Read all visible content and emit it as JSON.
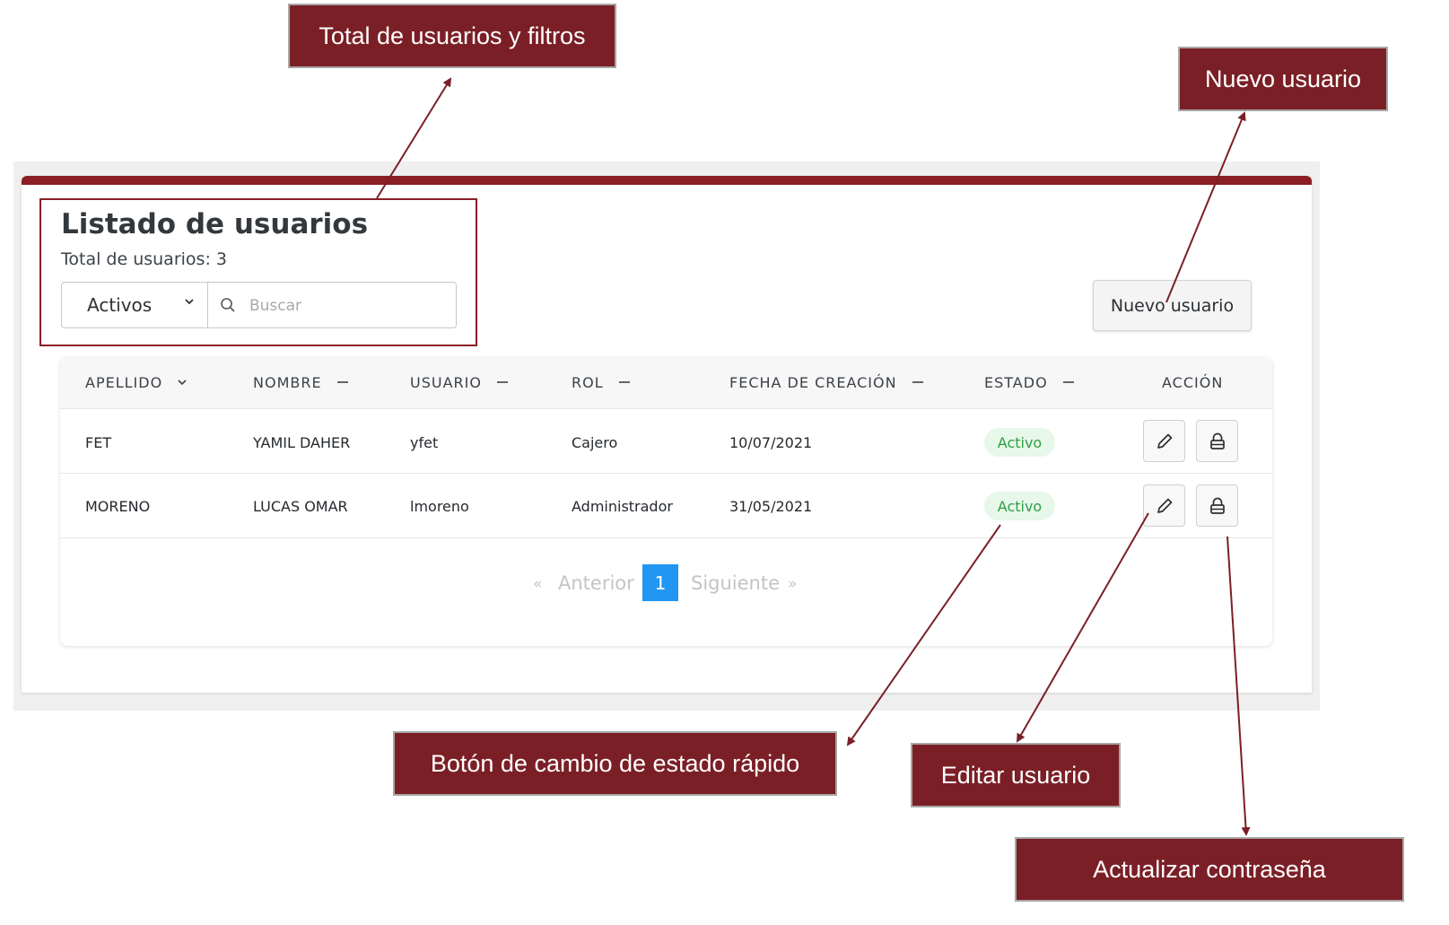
{
  "annotations": {
    "filters": "Total de usuarios y filtros",
    "new_user": "Nuevo usuario",
    "status_toggle": "Botón de cambio de estado rápido",
    "edit_user": "Editar usuario",
    "update_password": "Actualizar contraseña"
  },
  "colors": {
    "accent": "#8c1e26",
    "annotation_bg": "#7b1f26",
    "status_bg": "#e7f7ea",
    "status_text": "#2ea043",
    "pagination_active": "#2196f3"
  },
  "page": {
    "title": "Listado de usuarios",
    "total": "Total de usuarios: 3"
  },
  "filters": {
    "status_selected": "Activos",
    "search_placeholder": "Buscar"
  },
  "toolbar": {
    "new_user_label": "Nuevo usuario"
  },
  "table": {
    "headers": {
      "apellido": "APELLIDO",
      "nombre": "NOMBRE",
      "usuario": "USUARIO",
      "rol": "ROL",
      "fecha": "FECHA DE CREACIÓN",
      "estado": "ESTADO",
      "accion": "ACCIÓN"
    },
    "sort_icons": {
      "apellido": "chevron-down-icon",
      "others": "dash-icon"
    },
    "rows": [
      {
        "apellido": "FET",
        "nombre": "YAMIL DAHER",
        "usuario": "yfet",
        "rol": "Cajero",
        "fecha": "10/07/2021",
        "estado": "Activo",
        "actions": [
          "pencil-icon",
          "lock-icon"
        ]
      },
      {
        "apellido": "MORENO",
        "nombre": "LUCAS OMAR",
        "usuario": "lmoreno",
        "rol": "Administrador",
        "fecha": "31/05/2021",
        "estado": "Activo",
        "actions": [
          "pencil-icon",
          "lock-icon"
        ]
      }
    ]
  },
  "pagination": {
    "first": "«",
    "prev": "Anterior",
    "current": "1",
    "next": "Siguiente",
    "last": "»"
  }
}
